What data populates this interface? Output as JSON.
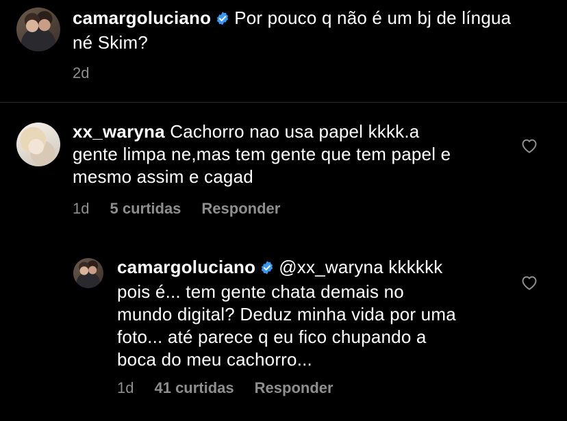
{
  "caption": {
    "username": "camargoluciano",
    "verified_icon": "verified-badge-icon",
    "text_line1": "Por pouco q não é um bj de língua",
    "text_line2": "né Skim?",
    "time": "2d"
  },
  "comment": {
    "username": "xx_waryna",
    "text_line1": "Cachorro nao usa papel kkkk.a",
    "text_line2": "gente limpa ne,mas tem gente que tem papel e",
    "text_line3": "mesmo assim e cagad",
    "time": "1d",
    "likes": "5 curtidas",
    "reply_label": "Responder",
    "like_icon": "heart-outline-icon"
  },
  "reply": {
    "username": "camargoluciano",
    "verified_icon": "verified-badge-icon",
    "text_line1": "@xx_waryna kkkkkk",
    "text_line2": "pois é... tem gente chata demais no",
    "text_line3": "mundo digital? Deduz minha vida por uma",
    "text_line4": "foto... até parece q eu fico chupando a",
    "text_line5": "boca do meu cachorro...",
    "time": "1d",
    "likes": "41 curtidas",
    "reply_label": "Responder",
    "like_icon": "heart-outline-icon"
  },
  "colors": {
    "background": "#000000",
    "text": "#ffffff",
    "secondary": "#8e8e8e",
    "verified": "#3897f0"
  }
}
